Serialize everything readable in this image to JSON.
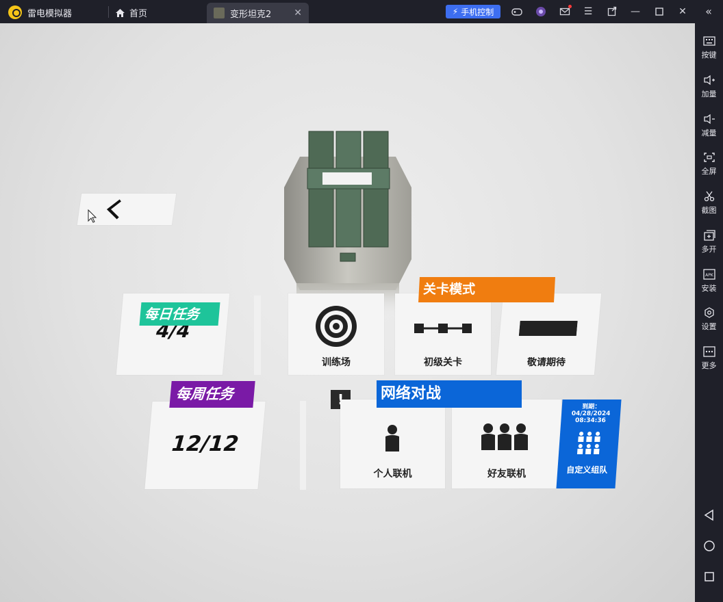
{
  "titlebar": {
    "app_name": "雷电模拟器",
    "home_label": "首页",
    "tab_label": "变形坦克2",
    "phone_control": "手机控制"
  },
  "game": {
    "daily_task": {
      "title": "每日任务",
      "value": "4/4"
    },
    "weekly_task": {
      "title": "每周任务",
      "value": "12/12"
    },
    "level_mode": {
      "title": "关卡模式"
    },
    "training": {
      "label": "训练场"
    },
    "beginner": {
      "label": "初级关卡"
    },
    "coming_soon": {
      "label": "敬请期待"
    },
    "network": {
      "title": "网络对战"
    },
    "solo": {
      "label": "个人联机"
    },
    "friends": {
      "label": "好友联机"
    },
    "custom_team": {
      "expire_label": "到期：",
      "date": "04/28/2024",
      "time": "08:34:36",
      "label": "自定义组队"
    },
    "alert_mark": "!"
  },
  "sidebar": {
    "items": [
      {
        "label": "按键",
        "icon": "keyboard-icon"
      },
      {
        "label": "加量",
        "icon": "volume-up-icon"
      },
      {
        "label": "减量",
        "icon": "volume-down-icon"
      },
      {
        "label": "全屏",
        "icon": "fullscreen-icon"
      },
      {
        "label": "截图",
        "icon": "scissors-icon"
      },
      {
        "label": "多开",
        "icon": "multi-instance-icon"
      },
      {
        "label": "安装",
        "icon": "apk-install-icon"
      },
      {
        "label": "设置",
        "icon": "settings-icon"
      },
      {
        "label": "更多",
        "icon": "more-icon"
      }
    ]
  },
  "colors": {
    "daily": "#1ec49a",
    "weekly": "#7a1aa6",
    "level": "#f07d10",
    "network": "#0b66d8"
  }
}
